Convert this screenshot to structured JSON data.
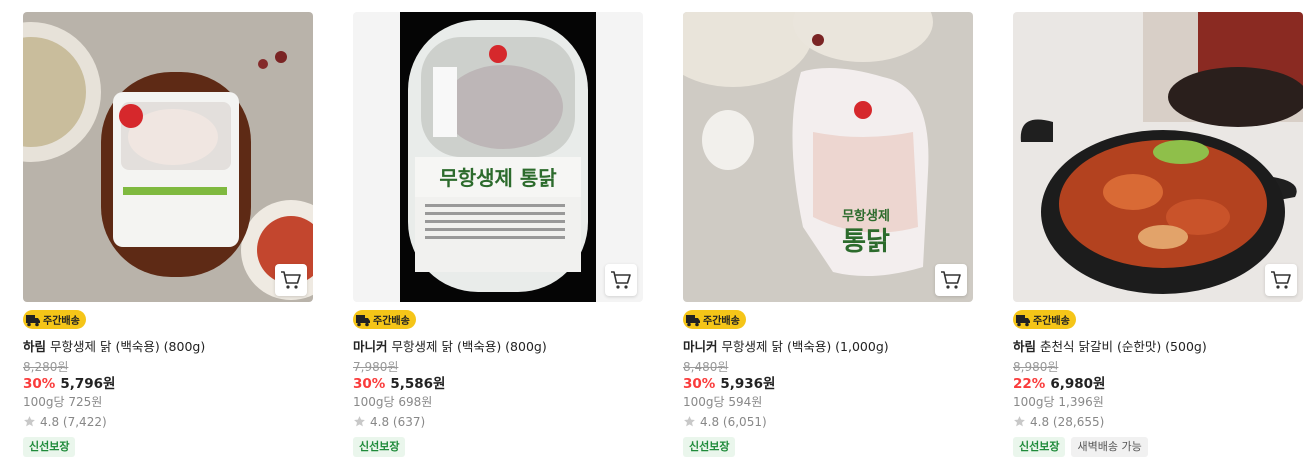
{
  "products": [
    {
      "brand": "하림",
      "name": "무항생제 닭 (백숙용) (800g)",
      "original_price": "8,280원",
      "discount": "30%",
      "price": "5,796원",
      "unit_price": "100g당 725원",
      "rating": "4.8",
      "reviews": "(7,422)",
      "delivery_badge": "주간배송",
      "tags": [
        "신선보장"
      ],
      "image_desc": "packaged whole chicken on brown tray"
    },
    {
      "brand": "마니커",
      "name": "무항생제 닭 (백숙용) (800g)",
      "original_price": "7,980원",
      "discount": "30%",
      "price": "5,586원",
      "unit_price": "100g당 698원",
      "rating": "4.8",
      "reviews": "(637)",
      "delivery_badge": "주간배송",
      "tags": [
        "신선보장"
      ],
      "package_text": "무항생제 통닭",
      "image_desc": "chicken tray package on black"
    },
    {
      "brand": "마니커",
      "name": "무항생제 닭 (백숙용) (1,000g)",
      "original_price": "8,480원",
      "discount": "30%",
      "price": "5,936원",
      "unit_price": "100g당 594원",
      "rating": "4.8",
      "reviews": "(6,051)",
      "delivery_badge": "주간배송",
      "tags": [
        "신선보장"
      ],
      "package_text_top": "무항생제",
      "package_text_bottom": "통닭",
      "image_desc": "chicken in plastic bag"
    },
    {
      "brand": "하림",
      "name": "춘천식 닭갈비 (순한맛) (500g)",
      "original_price": "8,980원",
      "discount": "22%",
      "price": "6,980원",
      "unit_price": "100g당 1,396원",
      "rating": "4.8",
      "reviews": "(28,655)",
      "delivery_badge": "주간배송",
      "tags": [
        "신선보장",
        "새벽배송 가능"
      ],
      "image_desc": "spicy chicken in iron pan"
    }
  ],
  "colors": {
    "discount": "#fa3c3c",
    "badge": "#f5c518",
    "fresh_tag_bg": "#eaf6ec",
    "fresh_tag_text": "#1f8b3a"
  },
  "icons": {
    "cart": "cart-icon",
    "truck": "truck-icon",
    "star": "star-icon"
  }
}
